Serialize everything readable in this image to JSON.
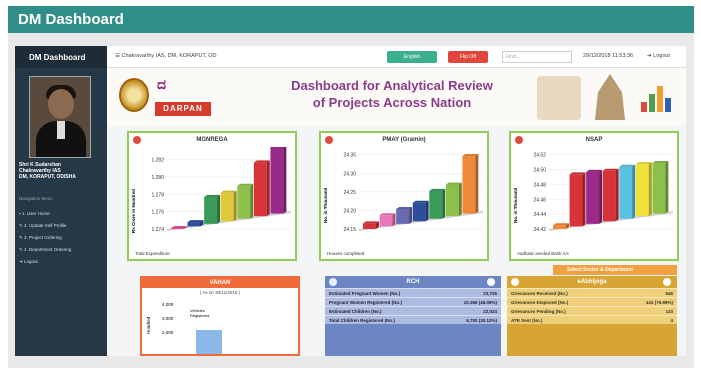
{
  "figure": {
    "title": "DM Dashboard"
  },
  "sidebar": {
    "title": "DM Dashboard",
    "user_line1": "Shri K Sudarshan",
    "user_line2": "Chakravarthy IAS",
    "user_line3": "DM, KORAPUT, ODISHA",
    "nav_heading": "Navigation Menu",
    "nav_items": [
      "1. User Home",
      "2. Update Self Profile",
      "3. Project Ordering",
      "4. Department Ordering",
      "Logout"
    ]
  },
  "topbar": {
    "user": "Chakravarthy IAS, DM, KORAPUT, OD",
    "english_label": "English",
    "flip_label": "Flip Off",
    "find_placeholder": "Find...",
    "datetime": "29/12/2018 11:53:36",
    "logout_label": "Logout"
  },
  "banner": {
    "logo_text": "DARPAN",
    "title_line1": "Dashboard for Analytical Review",
    "title_line2": "of Projects Across Nation"
  },
  "colors": {
    "accent": "#2f8f88",
    "sidebar": "#263746",
    "panel_border": "#8fcc5a",
    "vahan": "#f06b38",
    "rch": "#6c86c4",
    "eabhijoga": "#d6a534"
  },
  "chart_data": [
    {
      "type": "bar",
      "title": "MGNREGA",
      "ylabel": "Rs Crore in Hundred",
      "footer": "Total Expenditure",
      "yticks": [
        "1.274",
        "1.276",
        "1.278",
        "1.280",
        "1.282"
      ],
      "ylim": [
        1.274,
        1.283
      ],
      "values": [
        1.2741,
        1.2745,
        1.2771,
        1.2773,
        1.2778,
        1.2802,
        1.2821
      ],
      "colors": [
        "#e84a8a",
        "#2e4d9a",
        "#3a9a5a",
        "#dfc83a",
        "#8cc04a",
        "#d9333a",
        "#9a2a8a"
      ]
    },
    {
      "type": "bar",
      "title": "PMAY (Gramin)",
      "ylabel": "No. in Thousand",
      "footer": "Houses completed",
      "yticks": [
        "24.15",
        "24.20",
        "24.25",
        "24.30",
        "24.35"
      ],
      "ylim": [
        24.15,
        24.36
      ],
      "values": [
        24.165,
        24.18,
        24.19,
        24.2,
        24.225,
        24.235,
        24.305
      ],
      "colors": [
        "#d9333a",
        "#e878b8",
        "#6a6ab0",
        "#2e4d9a",
        "#3a9a5a",
        "#8cc04a",
        "#f0883a"
      ]
    },
    {
      "type": "bar",
      "title": "NSAP",
      "ylabel": "No. in Thousand",
      "footer": "Aadhaar seeded Bank A/c",
      "yticks": [
        "24.42",
        "24.44",
        "24.46",
        "24.48",
        "24.50",
        "24.52"
      ],
      "ylim": [
        24.42,
        24.525
      ],
      "values": [
        24.425,
        24.49,
        24.49,
        24.488,
        24.49,
        24.49,
        24.488
      ],
      "colors": [
        "#f0883a",
        "#d9333a",
        "#9a2a8a",
        "#d9333a",
        "#5ac0e0",
        "#f0e03a",
        "#8cc04a"
      ]
    }
  ],
  "selector_label": "Select Sector & Department",
  "vahan": {
    "title": "VAHAN",
    "asof": "( As on 30/11/2018 )",
    "ylabel": "Hundred",
    "yticks": [
      "4,000",
      "3,000",
      "2,000"
    ],
    "legend": "Vehicles Registered"
  },
  "rch": {
    "title": "RCH",
    "rows": [
      {
        "label": "Estimated Pregnant Women (No.)",
        "value": "23,735"
      },
      {
        "label": "Pregnant Women Registered (No.)",
        "value": "10,366 (46.06%)"
      },
      {
        "label": "Estimated Children (No.)",
        "value": "22,024"
      },
      {
        "label": "Total Children Registered (No.)",
        "value": "6,700 (30.12%)"
      }
    ]
  },
  "eabhijoga": {
    "title": "eAbhijoga",
    "rows": [
      {
        "label": "Grievances Received (No.)",
        "value": "546"
      },
      {
        "label": "Grievances Disposed (No.)",
        "value": "434 (79.89%)"
      },
      {
        "label": "Grievances Pending (No.)",
        "value": "110"
      },
      {
        "label": "ATR Sent (No.)",
        "value": "4"
      }
    ]
  }
}
